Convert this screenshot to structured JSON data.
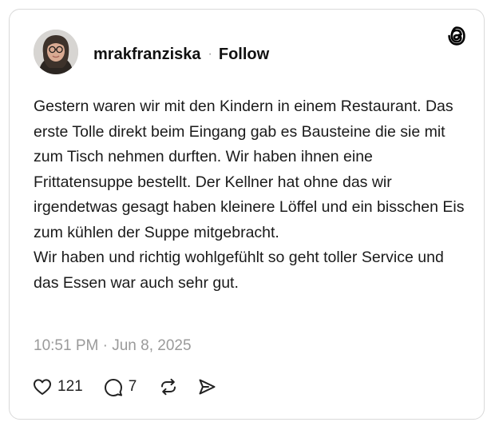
{
  "post": {
    "username": "mrakfranziska",
    "separator": "·",
    "follow_label": "Follow",
    "text_paragraphs": [
      "Gestern waren wir mit den Kindern in einem Restaurant. Das erste Tolle direkt beim Eingang gab es Bausteine die sie mit zum Tisch nehmen durften. Wir haben ihnen eine Frittatensuppe bestellt. Der Kellner hat ohne das wir irgendetwas gesagt haben kleinere Löffel und ein bisschen Eis zum kühlen der Suppe mitgebracht.",
      "Wir haben und richtig wohlgefühlt so geht toller Service und das Essen war auch sehr gut."
    ],
    "timestamp": "10:51 PM · Jun 8, 2025",
    "likes": "121",
    "replies": "7"
  },
  "icons": {
    "brand": "threads-logo-icon",
    "like": "heart-icon",
    "reply": "comment-icon",
    "repost": "repost-icon",
    "share": "send-icon"
  },
  "colors": {
    "text": "#1a1a1a",
    "muted": "#9a9a9a",
    "border": "#d9d9d9"
  }
}
